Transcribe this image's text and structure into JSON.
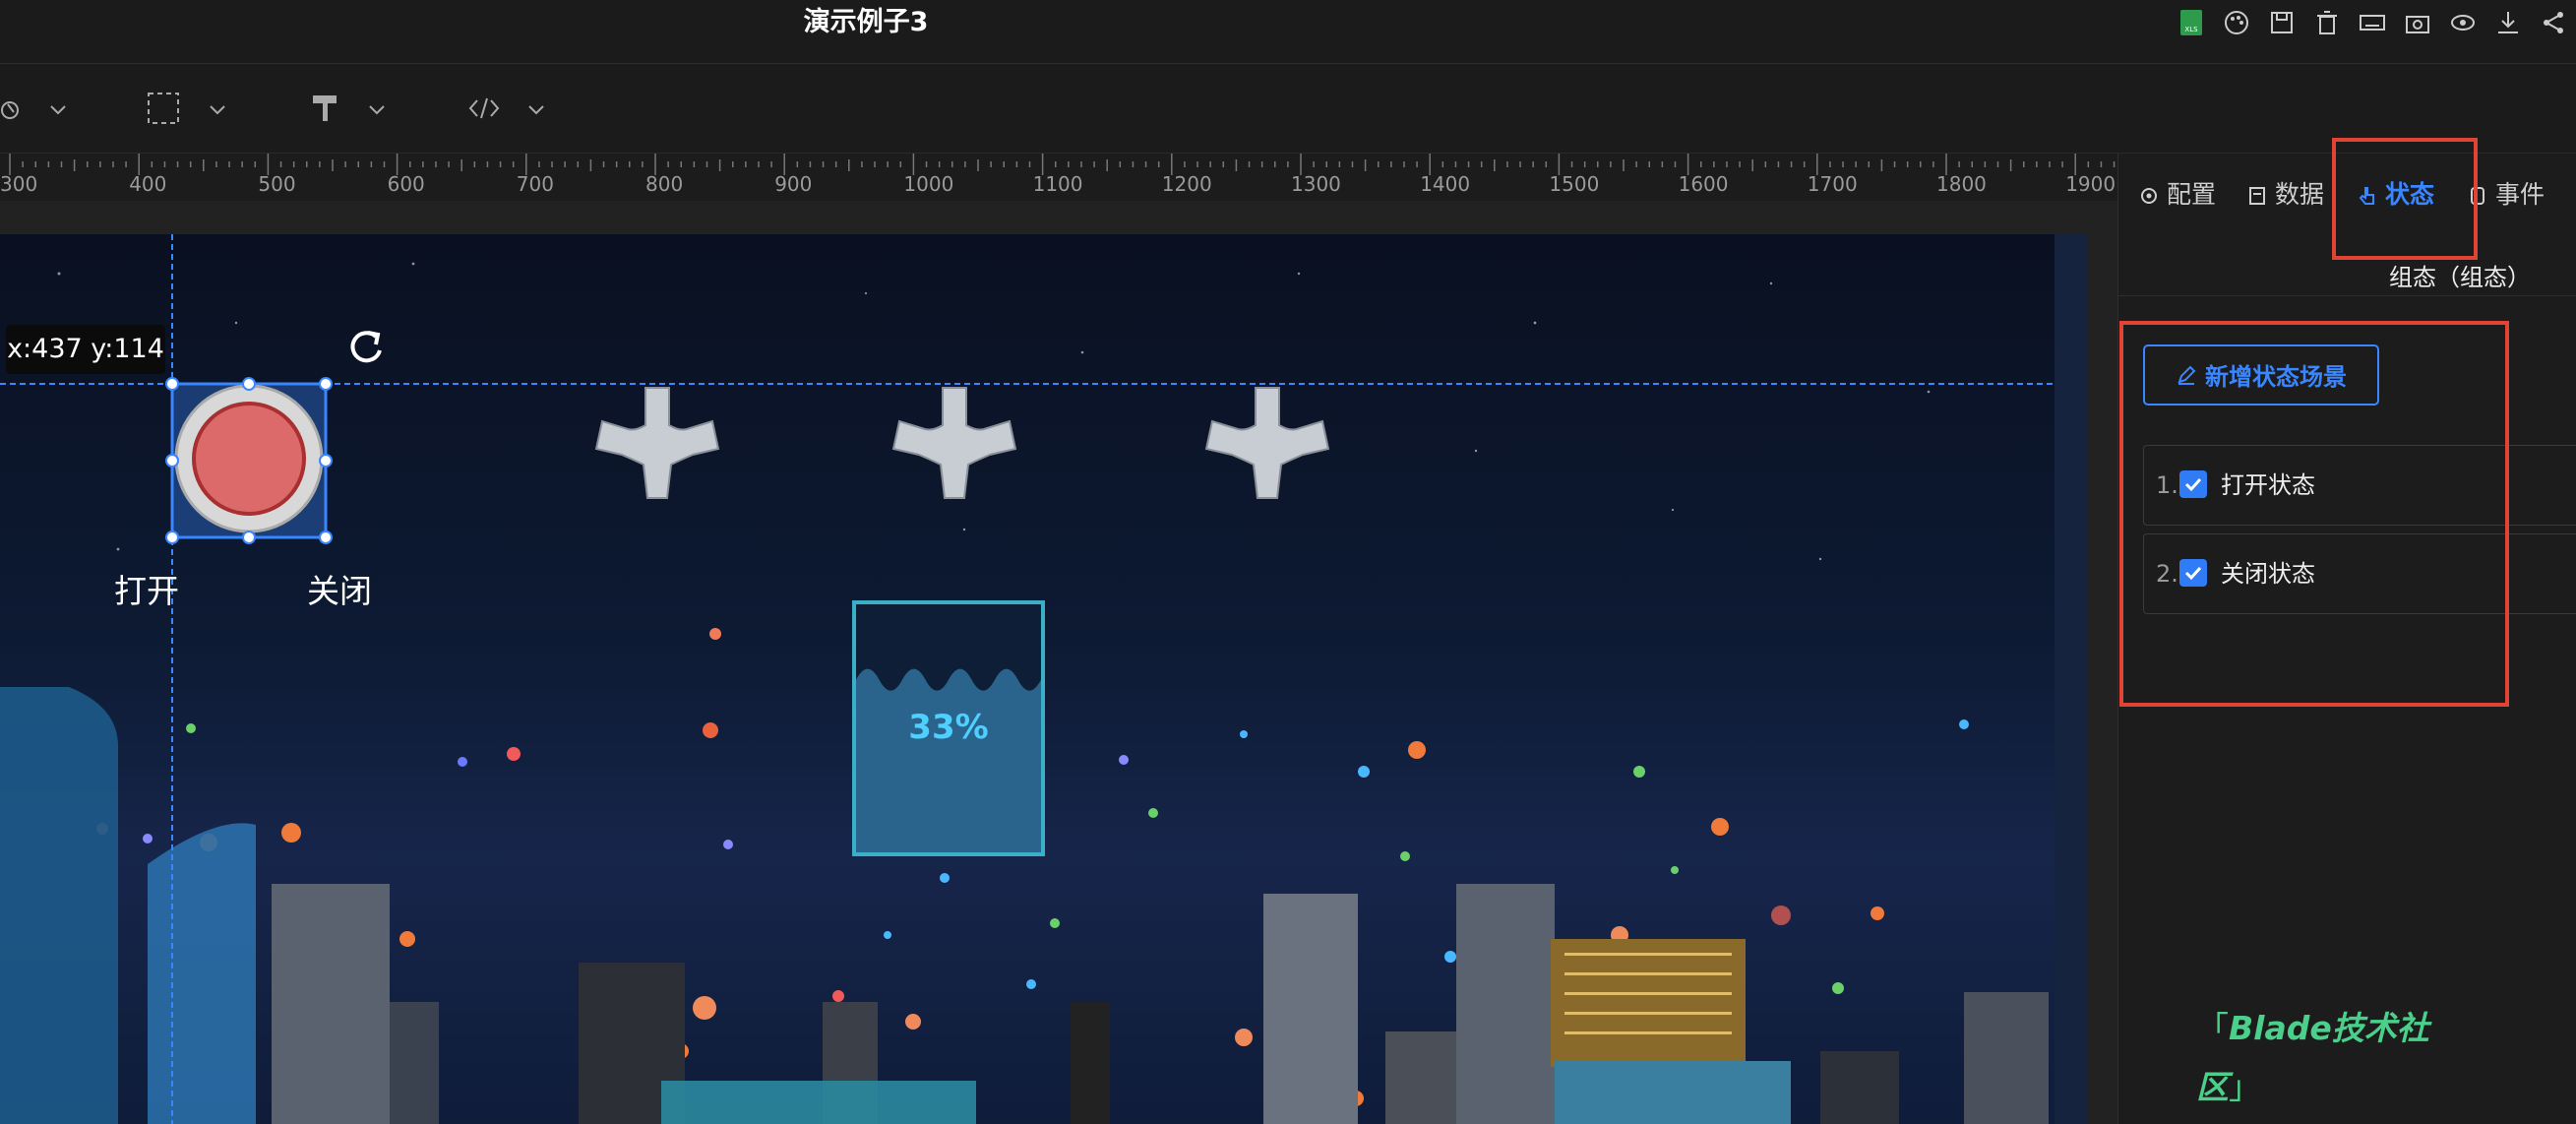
{
  "header": {
    "title": "演示例子3"
  },
  "toolbar": {
    "icons": [
      "xls-export-icon",
      "palette-icon",
      "save-icon",
      "trash-icon",
      "keyboard-icon",
      "camera-icon",
      "eye-icon",
      "download-icon",
      "share-icon"
    ]
  },
  "ruler": {
    "ticks": [
      "300",
      "400",
      "500",
      "600",
      "700",
      "800",
      "900",
      "1000",
      "1100",
      "1200",
      "1300",
      "1400",
      "1500",
      "1600",
      "1700",
      "1800",
      "1900"
    ]
  },
  "canvas": {
    "coordinate_readout": "x:437 y:114",
    "button_labels": {
      "open": "打开",
      "close": "关闭"
    },
    "water_level": {
      "text": "33%",
      "value": 0.33
    }
  },
  "panel": {
    "tabs": [
      {
        "label": "配置",
        "icon": "gear-icon"
      },
      {
        "label": "数据",
        "icon": "data-icon"
      },
      {
        "label": "状态",
        "icon": "hand-pointer-icon",
        "active": true
      },
      {
        "label": "事件",
        "icon": "event-icon"
      }
    ],
    "subtitle": "组态（组态）",
    "add_button": "新增状态场景",
    "states": [
      {
        "index": "1.",
        "label": "打开状态",
        "checked": true
      },
      {
        "index": "2.",
        "label": "关闭状态",
        "checked": true
      }
    ]
  },
  "watermark": {
    "text": "Blade技术社区"
  },
  "colors": {
    "accent": "#3a86ff",
    "highlight": "#e04434",
    "watermark": "#4ad08a"
  }
}
